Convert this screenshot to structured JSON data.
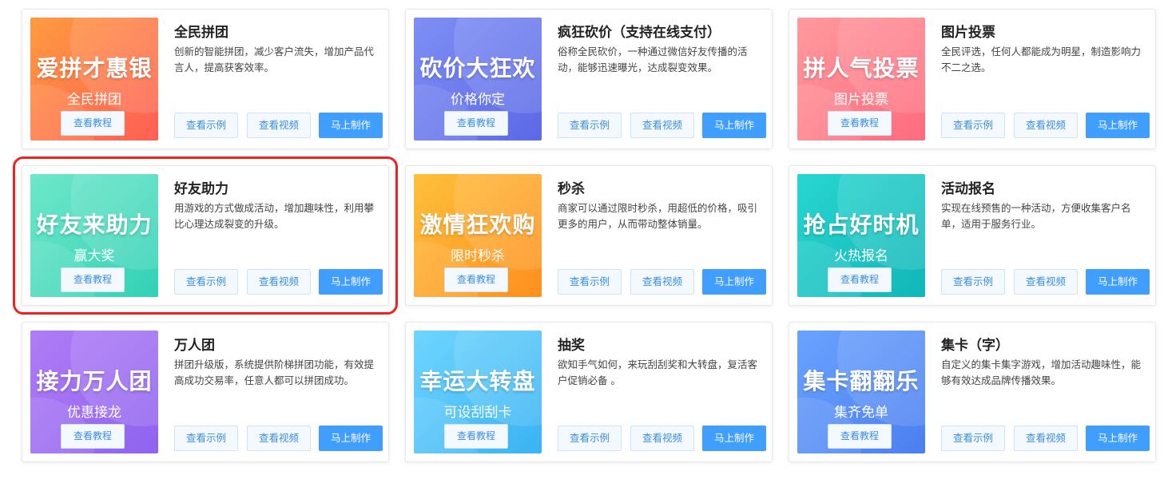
{
  "buttons": {
    "tutorial": "查看教程",
    "example": "查看示例",
    "video": "查看视频",
    "make": "马上制作"
  },
  "cards": [
    {
      "title": "全民拼团",
      "desc": "创新的智能拼团，减少客户流失，增加产品代言人，提高获客效率。",
      "thumb_title": "爱拼才惠银",
      "thumb_sub": "全民拼团",
      "colors": [
        "#ff9b3f",
        "#ff5f55"
      ]
    },
    {
      "title": "疯狂砍价（支持在线支付）",
      "desc": "俗称全民砍价，一种通过微信好友传播的活动，能够迅速曝光，达成裂变效果。",
      "thumb_title": "砍价大狂欢",
      "thumb_sub": "价格你定",
      "colors": [
        "#7f8ff5",
        "#5b69e6"
      ]
    },
    {
      "title": "图片投票",
      "desc": "全民评选，任何人都能成为明星，制造影响力不二之选。",
      "thumb_title": "拼人气投票",
      "thumb_sub": "图片投票",
      "colors": [
        "#ff9a9e",
        "#ff6b7e"
      ]
    },
    {
      "title": "好友助力",
      "desc": "用游戏的方式做成活动，增加趣味性，利用攀比心理达成裂变的升级。",
      "thumb_title": "好友来助力",
      "thumb_sub": "赢大奖",
      "colors": [
        "#6ee8c9",
        "#32d1b6"
      ]
    },
    {
      "title": "秒杀",
      "desc": "商家可以通过限时秒杀，用超低的价格，吸引更多的用户，从而带动整体销量。",
      "thumb_title": "激情狂欢购",
      "thumb_sub": "限时秒杀",
      "colors": [
        "#ffc03a",
        "#ff8f1f"
      ]
    },
    {
      "title": "活动报名",
      "desc": "实现在线预售的一种活动，方便收集客户名单，适用于服务行业。",
      "thumb_title": "抢占好时机",
      "thumb_sub": "火热报名",
      "colors": [
        "#28d6d0",
        "#12b6b8"
      ]
    },
    {
      "title": "万人团",
      "desc": "拼团升级版，系统提供阶梯拼团功能，有效提高成功交易率，任意人都可以拼团成功。",
      "thumb_title": "接力万人团",
      "thumb_sub": "优惠接龙",
      "colors": [
        "#b07cf6",
        "#8f63ef"
      ]
    },
    {
      "title": "抽奖",
      "desc": "欲知手气如何，来玩刮刮奖和大转盘，复活客户促销必备 。",
      "thumb_title": "幸运大转盘",
      "thumb_sub": "可设刮刮卡",
      "colors": [
        "#6fd5ff",
        "#39b3f2"
      ]
    },
    {
      "title": "集卡（字）",
      "desc": "自定义的集卡集字游戏，增加活动趣味性，能够有效达成品牌传播效果。",
      "thumb_title": "集卡翻翻乐",
      "thumb_sub": "集齐免单",
      "colors": [
        "#6aa3ff",
        "#4b7ff0"
      ]
    }
  ],
  "selected_index": 3
}
